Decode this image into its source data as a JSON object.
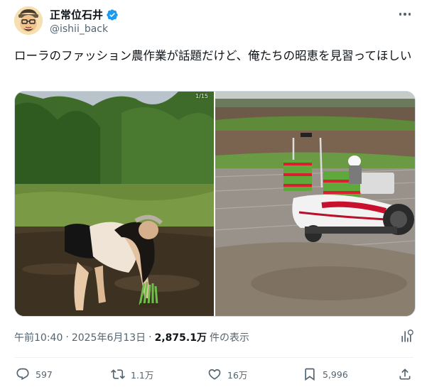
{
  "post": {
    "author": {
      "display_name": "正常位石井",
      "handle": "@ishii_back",
      "verified": true,
      "avatar_icon": "cartoon-avatar"
    },
    "text": "ローラのファッション農作業が話題だけど、俺たちの昭恵を見習ってほしい",
    "media": {
      "counter": "1/15",
      "items": [
        {
          "icon": "photo-woman-planting-rice"
        },
        {
          "icon": "photo-rice-transplanter"
        }
      ]
    },
    "meta": {
      "time": "午前10:40",
      "separator": "·",
      "date": "2025年6月13日",
      "views": "2,875.1万",
      "views_label": "件の表示"
    },
    "actions": {
      "replies": "597",
      "reposts": "1.1万",
      "likes": "16万",
      "bookmarks": "5,996"
    }
  },
  "colors": {
    "text": "#0f1419",
    "secondary": "#536471",
    "verified": "#1d9bf0",
    "divider": "#eff3f4"
  }
}
